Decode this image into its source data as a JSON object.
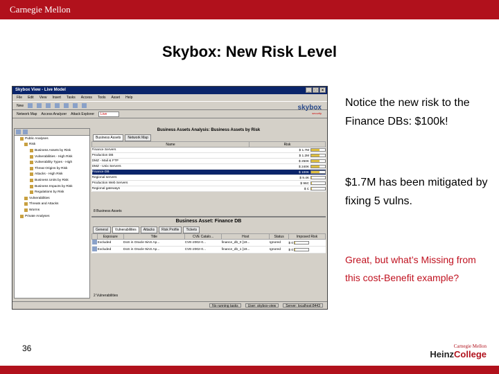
{
  "header": {
    "logo": "Carnegie Mellon"
  },
  "slide": {
    "title": "Skybox: New Risk Level",
    "note1": "Notice the new risk to the Finance DBs: $100k!",
    "note2": "$1.7M has been mitigated by fixing 5 vulns.",
    "note3": "Great, but what’s Missing from this cost-Benefit example?",
    "page_number": "36"
  },
  "footer_logo": {
    "top": "Carnegie Mellon",
    "heinz": "Heinz",
    "college": "College"
  },
  "colors": {
    "brand": "#b1111c",
    "window_title": "#0a246a"
  },
  "app": {
    "title": "Skybox View - Live Model",
    "menu": [
      "File",
      "Edit",
      "View",
      "Insert",
      "Tasks",
      "Access",
      "Tools",
      "Asset",
      "Help"
    ],
    "toolbar1": {
      "new_label": "New"
    },
    "toolbar2": {
      "network_map": "Network Map",
      "access_analyzer": "Access Analyzer",
      "attack_explorer": "Attack Explorer",
      "model": "Live"
    },
    "brand": {
      "name": "skybox",
      "sub": "security"
    },
    "tree": [
      "Public Analyses",
      "Risk",
      "Business Assets by Risk",
      "Vulnerabilities - High Risk",
      "Vulnerability Types - High",
      "Threat Origins by Risk",
      "Attacks - High Risk",
      "Business Units by Risk",
      "Business Impacts by Risk",
      "Regulations by Risk",
      "Vulnerabilities",
      "Threats and Attacks",
      "Worms",
      "Private Analyses"
    ],
    "main": {
      "title": "Business Assets Analysis: Business Assets by Risk",
      "tabs": [
        "Business Assets",
        "Network Map"
      ],
      "columns": [
        "Name",
        "Risk"
      ],
      "rows": [
        {
          "name": "Finance Servers",
          "risk": "$ 1.7M"
        },
        {
          "name": "Production DB",
          "risk": "$ 1.2M"
        },
        {
          "name": "DMZ - Mail & FTP",
          "risk": "$ 250K"
        },
        {
          "name": "DMZ - Unix Servers",
          "risk": "$ 240K"
        },
        {
          "name": "Finance DB",
          "risk": "$ 100K"
        },
        {
          "name": "Regional servers",
          "risk": "$ 9.4K"
        },
        {
          "name": "Production Web Servers",
          "risk": "$ 96C"
        },
        {
          "name": "Regional gateways",
          "risk": "$ C"
        }
      ],
      "footer": "8 Business Assets"
    },
    "detail": {
      "title": "Business Asset: Finance DB",
      "tabs": [
        "General",
        "Vulnerabilities",
        "Attacks",
        "Risk Profile",
        "Tickets"
      ],
      "columns": [
        "",
        "Exposure",
        "Title",
        "CVE Catalo...",
        "Host",
        "Status",
        "Imposed Risk"
      ],
      "rows": [
        {
          "exposure": "Excluded",
          "title": "DoS in Oracle 9iAS Ap...",
          "cve": "CVE-2002-0...",
          "host": "finance_db_0 [19...",
          "status": "Ignored",
          "risk": "$ 0"
        },
        {
          "exposure": "Excluded",
          "title": "DoS in Oracle 9iAS Ap...",
          "cve": "CVE-2002-0...",
          "host": "finance_db_1 [19...",
          "status": "Ignored",
          "risk": "$ 0"
        }
      ],
      "footer": "2 Vulnerabilities"
    },
    "status": {
      "tasks": "No running tasks",
      "user": "User: skybox-view",
      "server": "Server: localhost:8443"
    }
  }
}
